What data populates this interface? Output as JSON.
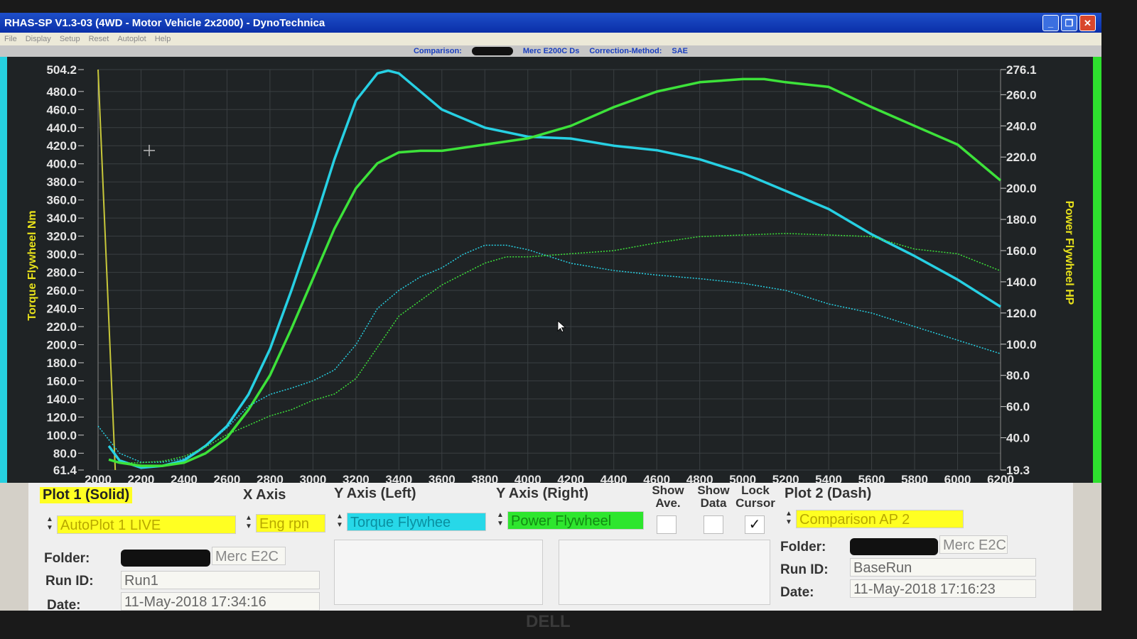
{
  "window": {
    "title": "RHAS-SP V1.3-03  (4WD - Motor Vehicle 2x2000) - DynoTechnica",
    "menu": [
      "File",
      "Display",
      "Setup",
      "Reset",
      "Autoplot",
      "Help"
    ]
  },
  "infobar": {
    "comparison_label": "Comparison:",
    "comparison_value": "Merc E200C Ds",
    "correction_label": "Correction-Method:",
    "correction_value": "SAE"
  },
  "colors": {
    "plot_bg": "#1f2325",
    "torque": "#27d0e3",
    "power": "#3de23a",
    "axis_label": "#e8e21b",
    "cursor": "#c8c83a"
  },
  "chart_data": {
    "type": "line",
    "xlabel": "",
    "ylabel_left": "Torque Flywheel Nm",
    "ylabel_right": "Power Flywheel HP",
    "xlim": [
      2000,
      6200
    ],
    "ylim_left": [
      61.4,
      504.2
    ],
    "ylim_right": [
      19.3,
      276.1
    ],
    "x_ticks": [
      "2000",
      "2200",
      "2400",
      "2600",
      "2800",
      "3000",
      "3200",
      "3400",
      "3600",
      "3800",
      "4000",
      "4200",
      "4400",
      "4600",
      "4800",
      "5000",
      "5200",
      "5400",
      "5600",
      "5800",
      "6000",
      "6200"
    ],
    "y_left_ticks": [
      "504.2",
      "480.0",
      "460.0",
      "440.0",
      "420.0",
      "400.0",
      "380.0",
      "360.0",
      "340.0",
      "320.0",
      "300.0",
      "280.0",
      "260.0",
      "240.0",
      "220.0",
      "200.0",
      "180.0",
      "160.0",
      "140.0",
      "120.0",
      "100.0",
      "80.0",
      "61.4"
    ],
    "y_right_ticks": [
      "276.1",
      "260.0",
      "240.0",
      "220.0",
      "200.0",
      "180.0",
      "160.0",
      "140.0",
      "120.0",
      "100.0",
      "80.0",
      "60.0",
      "40.0",
      "19.3"
    ],
    "grid": true,
    "cursor_rpm": 2080,
    "series": [
      {
        "name": "Torque Flywheel",
        "axis": "left",
        "style": "solid",
        "color": "#27d0e3",
        "x": [
          2050,
          2100,
          2200,
          2300,
          2400,
          2500,
          2600,
          2700,
          2800,
          2900,
          3000,
          3100,
          3200,
          3300,
          3350,
          3400,
          3500,
          3600,
          3800,
          4000,
          4200,
          4400,
          4600,
          4800,
          5000,
          5200,
          5400,
          5600,
          5800,
          6000,
          6200
        ],
        "y": [
          88,
          72,
          64,
          66,
          72,
          88,
          110,
          145,
          195,
          260,
          330,
          405,
          470,
          500,
          503,
          500,
          480,
          460,
          440,
          430,
          428,
          420,
          415,
          405,
          390,
          370,
          350,
          322,
          298,
          272,
          242
        ]
      },
      {
        "name": "Power Flywheel",
        "axis": "right",
        "style": "solid",
        "color": "#3de23a",
        "x": [
          2050,
          2100,
          2200,
          2300,
          2400,
          2500,
          2600,
          2700,
          2800,
          2900,
          3000,
          3100,
          3200,
          3300,
          3400,
          3500,
          3600,
          3800,
          4000,
          4200,
          4400,
          4600,
          4800,
          5000,
          5100,
          5200,
          5400,
          5600,
          5800,
          6000,
          6200
        ],
        "y": [
          26,
          24,
          22,
          22,
          24,
          30,
          40,
          58,
          80,
          110,
          142,
          174,
          200,
          216,
          223,
          224,
          224,
          228,
          232,
          240,
          252,
          262,
          268,
          270,
          270,
          268,
          265,
          252,
          240,
          228,
          205
        ]
      },
      {
        "name": "Comparison AP 2 Torque",
        "axis": "left",
        "style": "dash",
        "color": "#27d0e3",
        "x": [
          2000,
          2100,
          2200,
          2300,
          2400,
          2500,
          2600,
          2700,
          2800,
          2900,
          3000,
          3100,
          3200,
          3300,
          3400,
          3500,
          3600,
          3700,
          3800,
          3900,
          4000,
          4200,
          4400,
          4600,
          4800,
          5000,
          5200,
          5400,
          5600,
          5800,
          6000,
          6200
        ],
        "y": [
          110,
          80,
          70,
          70,
          74,
          88,
          108,
          132,
          145,
          152,
          160,
          172,
          200,
          240,
          260,
          275,
          285,
          300,
          310,
          310,
          305,
          290,
          282,
          277,
          273,
          268,
          260,
          245,
          235,
          220,
          205,
          190
        ]
      },
      {
        "name": "Comparison AP 2 Power",
        "axis": "right",
        "style": "dash",
        "color": "#3de23a",
        "x": [
          2050,
          2100,
          2200,
          2300,
          2400,
          2500,
          2600,
          2700,
          2800,
          2900,
          3000,
          3100,
          3200,
          3300,
          3400,
          3500,
          3600,
          3700,
          3800,
          3900,
          4000,
          4200,
          4400,
          4600,
          4800,
          5000,
          5200,
          5400,
          5600,
          5800,
          6000,
          6200
        ],
        "y": [
          26,
          24,
          24,
          25,
          28,
          34,
          42,
          48,
          54,
          58,
          64,
          68,
          78,
          98,
          118,
          128,
          138,
          145,
          152,
          156,
          156,
          158,
          160,
          165,
          169,
          170,
          171,
          170,
          169,
          161,
          158,
          147
        ]
      }
    ]
  },
  "panel": {
    "plot1_title": "Plot 1 (Solid)",
    "xaxis_title": "X Axis",
    "yleft_title": "Y Axis (Left)",
    "yright_title": "Y Axis (Right)",
    "show_ave_l1": "Show",
    "show_ave_l2": "Ave.",
    "show_data_l1": "Show",
    "show_data_l2": "Data",
    "lock_cursor_l1": "Lock",
    "lock_cursor_l2": "Cursor",
    "plot2_title": "Plot 2 (Dash)",
    "plot1_select": "AutoPlot 1 LIVE",
    "xaxis_select": "Eng rpn",
    "yleft_select": "Torque Flywhee",
    "yright_select": "Power Flywheel",
    "plot2_select": "Comparison AP 2",
    "lock_cursor_checked": "✓",
    "folder_label": "Folder:",
    "runid_label": "Run ID:",
    "date_label": "Date:",
    "plot1_folder": "Merc E2C",
    "plot1_runid": "Run1",
    "plot1_date": "11-May-2018  17:34:16",
    "plot2_folder": "Merc E2C",
    "plot2_runid": "BaseRun",
    "plot2_date": "11-May-2018  17:16:23"
  },
  "monitor": {
    "brand": "DELL"
  }
}
